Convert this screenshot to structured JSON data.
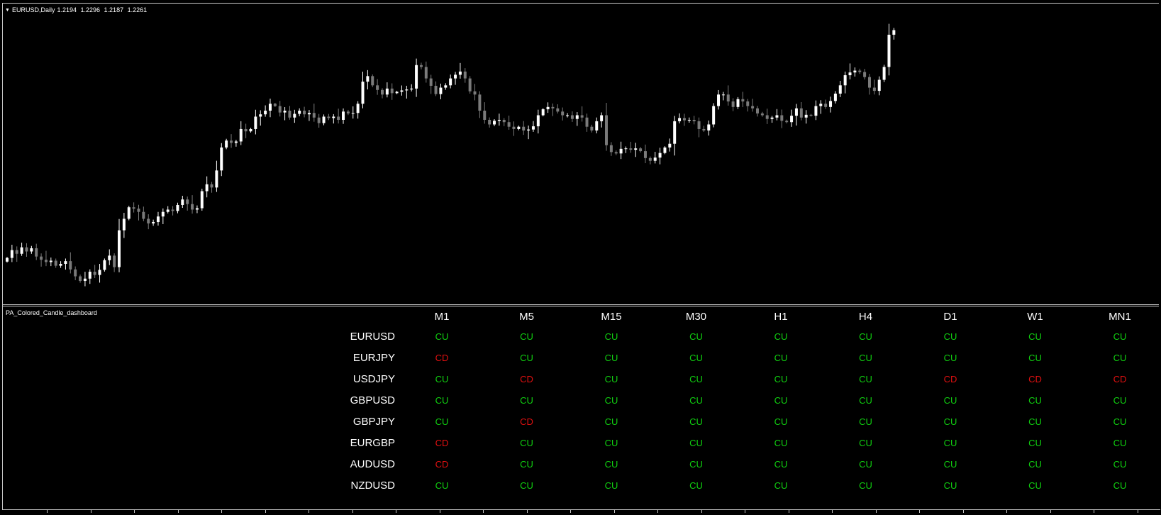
{
  "chart": {
    "symbol": "EURUSD,Daily",
    "open": "1.2194",
    "high": "1.2296",
    "low": "1.2187",
    "close": "1.2261"
  },
  "indicator": {
    "name": "PA_Colored_Candle_dashboard"
  },
  "colors": {
    "bull_candle": "#ffffff",
    "bear_candle": "#7a7a7a",
    "signal_up": "#10d010",
    "signal_down": "#e01010",
    "background": "#000000",
    "border": "#c8c8c8"
  },
  "dashboard": {
    "timeframes": [
      "M1",
      "M5",
      "M15",
      "M30",
      "H1",
      "H4",
      "D1",
      "W1",
      "MN1"
    ],
    "rows": [
      {
        "symbol": "EURUSD",
        "signals": [
          "CU",
          "CU",
          "CU",
          "CU",
          "CU",
          "CU",
          "CU",
          "CU",
          "CU"
        ]
      },
      {
        "symbol": "EURJPY",
        "signals": [
          "CD",
          "CU",
          "CU",
          "CU",
          "CU",
          "CU",
          "CU",
          "CU",
          "CU"
        ]
      },
      {
        "symbol": "USDJPY",
        "signals": [
          "CU",
          "CD",
          "CU",
          "CU",
          "CU",
          "CU",
          "CD",
          "CD",
          "CD"
        ]
      },
      {
        "symbol": "GBPUSD",
        "signals": [
          "CU",
          "CU",
          "CU",
          "CU",
          "CU",
          "CU",
          "CU",
          "CU",
          "CU"
        ]
      },
      {
        "symbol": "GBPJPY",
        "signals": [
          "CU",
          "CD",
          "CU",
          "CU",
          "CU",
          "CU",
          "CU",
          "CU",
          "CU"
        ]
      },
      {
        "symbol": "EURGBP",
        "signals": [
          "CD",
          "CU",
          "CU",
          "CU",
          "CU",
          "CU",
          "CU",
          "CU",
          "CU"
        ]
      },
      {
        "symbol": "AUDUSD",
        "signals": [
          "CD",
          "CU",
          "CU",
          "CU",
          "CU",
          "CU",
          "CU",
          "CU",
          "CU"
        ]
      },
      {
        "symbol": "NZDUSD",
        "signals": [
          "CU",
          "CU",
          "CU",
          "CU",
          "CU",
          "CU",
          "CU",
          "CU",
          "CU"
        ]
      }
    ]
  },
  "chart_data": {
    "type": "candlestick",
    "closes": [
      1.1805,
      1.1822,
      1.1814,
      1.1828,
      1.1819,
      1.1826,
      1.1808,
      1.1801,
      1.1796,
      1.1799,
      1.1788,
      1.1792,
      1.1798,
      1.178,
      1.1765,
      1.1755,
      1.176,
      1.1775,
      1.1768,
      1.1779,
      1.18,
      1.181,
      1.1785,
      1.1865,
      1.189,
      1.1915,
      1.1912,
      1.1905,
      1.189,
      1.188,
      1.1883,
      1.1895,
      1.1905,
      1.191,
      1.1907,
      1.192,
      1.1932,
      1.1922,
      1.191,
      1.1913,
      1.195,
      1.1965,
      1.1958,
      1.1995,
      1.2045,
      1.206,
      1.2055,
      1.2058,
      1.2085,
      1.208,
      1.2085,
      1.2112,
      1.2117,
      1.2125,
      1.214,
      1.2135,
      1.2121,
      1.2125,
      1.211,
      1.2118,
      1.2125,
      1.2117,
      1.212,
      1.211,
      1.2098,
      1.2112,
      1.2109,
      1.2112,
      1.2105,
      1.2123,
      1.2119,
      1.212,
      1.214,
      1.2188,
      1.22,
      1.218,
      1.217,
      1.216,
      1.2173,
      1.2163,
      1.2166,
      1.2169,
      1.2171,
      1.2173,
      1.2224,
      1.222,
      1.2195,
      1.2179,
      1.2161,
      1.2175,
      1.218,
      1.2195,
      1.2203,
      1.221,
      1.2195,
      1.2167,
      1.216,
      1.2125,
      1.2105,
      1.2095,
      1.2103,
      1.2105,
      1.21,
      1.209,
      1.2085,
      1.209,
      1.2082,
      1.2084,
      1.2091,
      1.2115,
      1.2128,
      1.2133,
      1.213,
      1.2123,
      1.2115,
      1.2115,
      1.2107,
      1.2115,
      1.211,
      1.209,
      1.2082,
      1.2102,
      1.2115,
      1.205,
      1.2035,
      1.2032,
      1.2042,
      1.2043,
      1.204,
      1.2043,
      1.2037,
      1.2022,
      1.2016,
      1.2023,
      1.2033,
      1.2045,
      1.2053,
      1.2102,
      1.2109,
      1.2104,
      1.2105,
      1.2102,
      1.2085,
      1.2082,
      1.2095,
      1.2135,
      1.216,
      1.216,
      1.2145,
      1.2133,
      1.215,
      1.2145,
      1.2135,
      1.213,
      1.2119,
      1.2115,
      1.2107,
      1.211,
      1.2115,
      1.2103,
      1.21,
      1.2114,
      1.213,
      1.211,
      1.2116,
      1.2114,
      1.2135,
      1.214,
      1.2133,
      1.2146,
      1.2162,
      1.218,
      1.2202,
      1.2208,
      1.2212,
      1.2209,
      1.2198,
      1.2175,
      1.2168,
      1.2192,
      1.222,
      1.229,
      1.23
    ]
  }
}
